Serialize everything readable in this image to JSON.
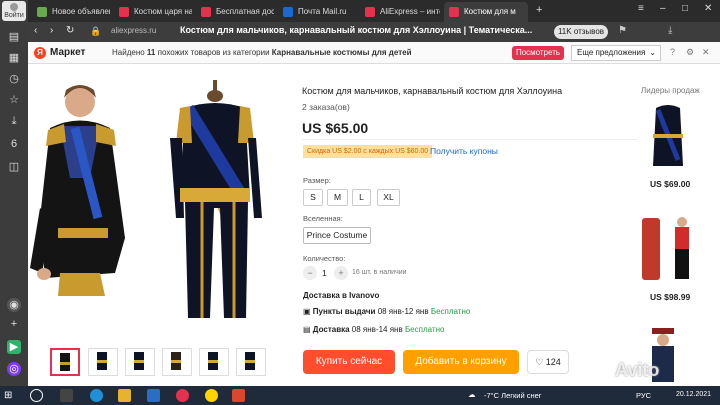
{
  "browser": {
    "profile_label": "Войти",
    "tabs": [
      {
        "label": "Новое объявлен",
        "color": "#6aa84f"
      },
      {
        "label": "Костюм царя на",
        "color": "#e4314e"
      },
      {
        "label": "Бесплатная дост",
        "color": "#e4314e"
      },
      {
        "label": "Почта Mail.ru",
        "color": "#1b6ad3"
      },
      {
        "label": "AliExpress – инте",
        "color": "#e4314e"
      },
      {
        "label": "Костюм для м",
        "color": "#e4314e"
      }
    ],
    "address_host": "aliexpress.ru",
    "page_title": "Костюм для мальчиков, карнавальный костюм для Хэллоуина | Тематическа...",
    "reviews_badge": "11K отзывов"
  },
  "yandex_bar": {
    "logo_letter": "Я",
    "brand": "Маркет",
    "text_prefix": "Найдено",
    "count": "11",
    "text_mid": "похожих товаров из категории",
    "category": "Карнавальные костюмы для детей",
    "see_button": "Посмотреть",
    "offers_select": "Еще предложения"
  },
  "product": {
    "title": "Костюм для мальчиков, карнавальный костюм для Хэллоуина",
    "orders": "2 заказа(ов)",
    "price": "US $65.00",
    "coupon": "Скидка US $2.00 с каждых US $60.00",
    "get_coupons": "Получить купоны",
    "size_label": "Размер:",
    "sizes": [
      "S",
      "M",
      "L",
      "XL"
    ],
    "universe_label": "Вселенная:",
    "universe_option": "Prince Costume",
    "quantity_label": "Количество:",
    "quantity": "1",
    "stock": "16 шт. в наличии",
    "delivery_title": "Доставка в Ivanovo",
    "pickup_label": "Пункты выдачи",
    "pickup_dates": "08 янв-12 янв",
    "pickup_price": "Бесплатно",
    "courier_label": "Доставка",
    "courier_dates": "08 янв-14 янв",
    "courier_price": "Бесплатно",
    "buy_now": "Купить сейчас",
    "add_to_cart": "Добавить в корзину",
    "wish_count": "124"
  },
  "leaders": {
    "title": "Лидеры продаж",
    "prices": [
      "US $69.00",
      "US $98.99"
    ]
  },
  "taskbar": {
    "weather": "-7°C Легкий снег",
    "lang": "РУС",
    "date": "20.12.2021"
  },
  "watermark": "Avito",
  "colors": {
    "accent": "#e4314e",
    "buy": "#ff4d2e",
    "cart": "#ff9f00",
    "link": "#1b6ad3"
  }
}
